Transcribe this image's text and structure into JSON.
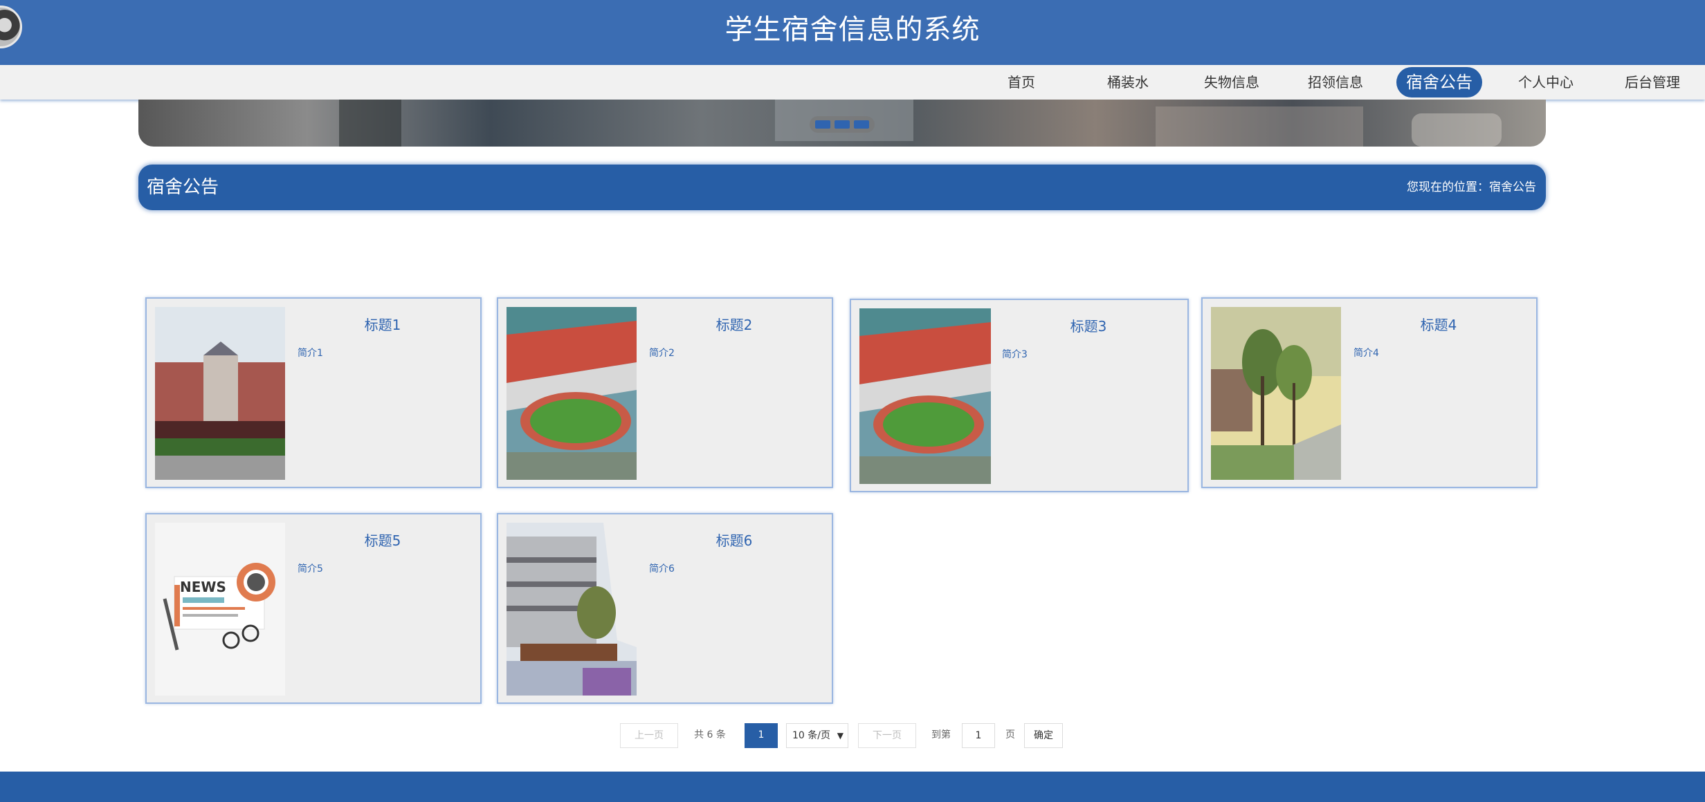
{
  "header": {
    "title": "学生宿舍信息的系统"
  },
  "nav": {
    "items": [
      {
        "label": "首页"
      },
      {
        "label": "桶装水"
      },
      {
        "label": "失物信息"
      },
      {
        "label": "招领信息"
      },
      {
        "label": "宿舍公告",
        "active": true
      },
      {
        "label": "个人中心"
      },
      {
        "label": "后台管理"
      }
    ]
  },
  "section": {
    "title": "宿舍公告",
    "breadcrumb": "您现在的位置：宿舍公告"
  },
  "cards": [
    {
      "title": "标题1",
      "desc": "简介1"
    },
    {
      "title": "标题2",
      "desc": "简介2"
    },
    {
      "title": "标题3",
      "desc": "简介3"
    },
    {
      "title": "标题4",
      "desc": "简介4"
    },
    {
      "title": "标题5",
      "desc": "简介5",
      "image_text": "NEWS"
    },
    {
      "title": "标题6",
      "desc": "简介6"
    }
  ],
  "pagination": {
    "prev": "上一页",
    "total": "共 6 条",
    "current": "1",
    "page_size": "10 条/页",
    "next": "下一页",
    "goto": "到第",
    "goto_value": "1",
    "page_unit": "页",
    "confirm": "确定"
  },
  "colors": {
    "primary": "#275ea6",
    "header": "#3b6db3",
    "card_bg": "#eeeeee"
  }
}
